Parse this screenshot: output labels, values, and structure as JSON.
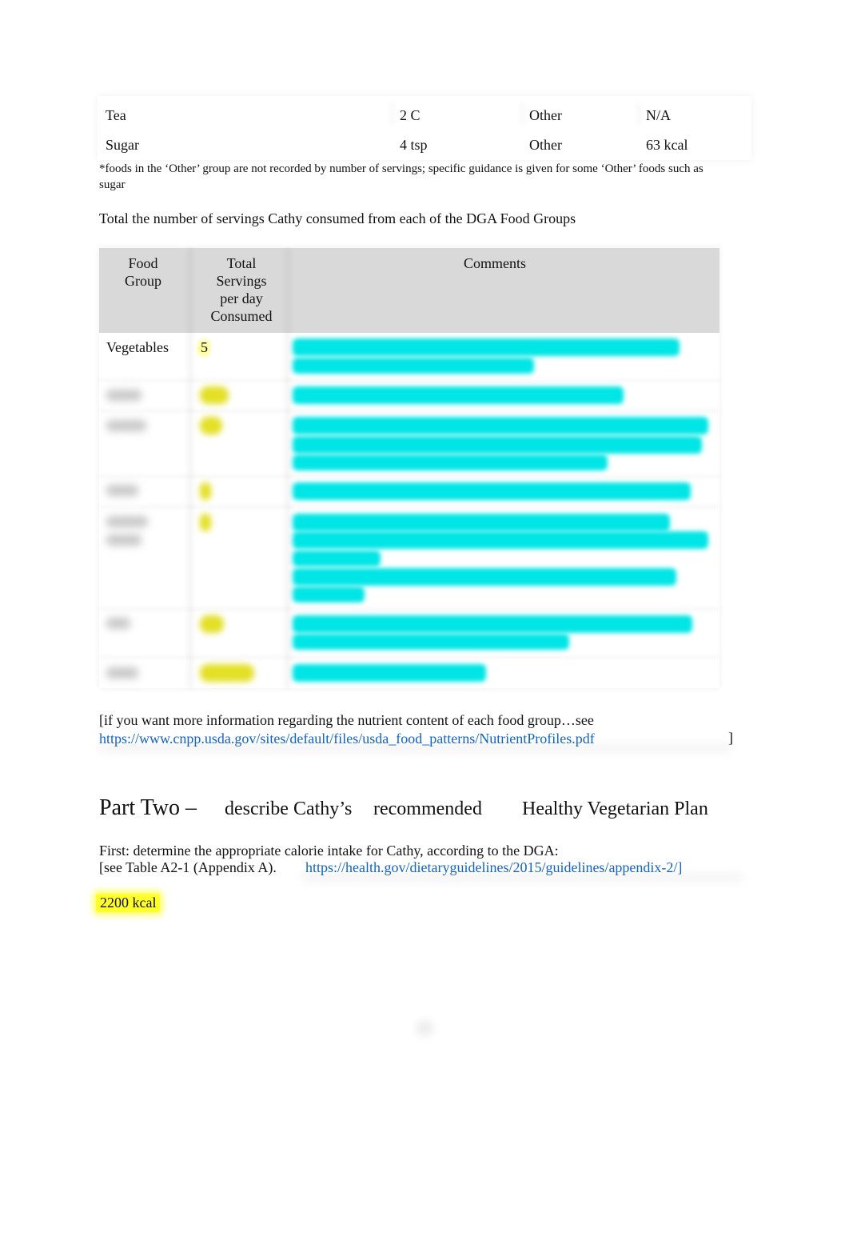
{
  "food_log_table": {
    "rows": [
      {
        "food": "Tea",
        "amount": "2 C",
        "group": "Other",
        "calories": "N/A"
      },
      {
        "food": "Sugar",
        "amount": "4 tsp",
        "group": "Other",
        "calories": "63 kcal"
      }
    ],
    "footnote": "*foods in the ‘Other’ group are not recorded by number of servings; specific guidance is given for some ‘Other’ foods such as sugar"
  },
  "servings_section": {
    "instruction": "Total the number of servings Cathy consumed from each of the DGA Food Groups",
    "table": {
      "headers": [
        "Food Group",
        "Total Servings per day Consumed",
        "Comments"
      ],
      "header_lines": {
        "food_group": [
          "Food",
          "Group"
        ],
        "servings": [
          "Total",
          "Servings",
          "per day",
          "Consumed"
        ],
        "comments": [
          "Comments"
        ]
      },
      "visible_rows": [
        {
          "food_group": "Vegetables",
          "servings": "5",
          "comments": "[blurred]"
        }
      ],
      "blurred_row_count": 6,
      "highlight_colors": {
        "servings": "#ffff2e",
        "comments": "#00e5e5"
      }
    }
  },
  "info_note": {
    "text": "[if you want more information regarding the nutrient content of each food group…see",
    "link": "https://www.cnpp.usda.gov/sites/default/files/usda_food_patterns/NutrientProfiles.pdf",
    "close": "]"
  },
  "part_two": {
    "title": "Part Two –",
    "subtitle_parts": [
      "describe Cathy’s",
      "recommended",
      "Healthy Vegetarian Plan"
    ],
    "first_step": "First: determine the appropriate calorie intake for Cathy, according to the DGA:",
    "see_text": "[see Table A2-1 (Appendix A).",
    "see_link": "https://health.gov/dietaryguidelines/2015/guidelines/appendix-2/]",
    "answer": "2200 kcal",
    "answer_highlight": "#ffff2e"
  },
  "link_color": "#1565c0"
}
